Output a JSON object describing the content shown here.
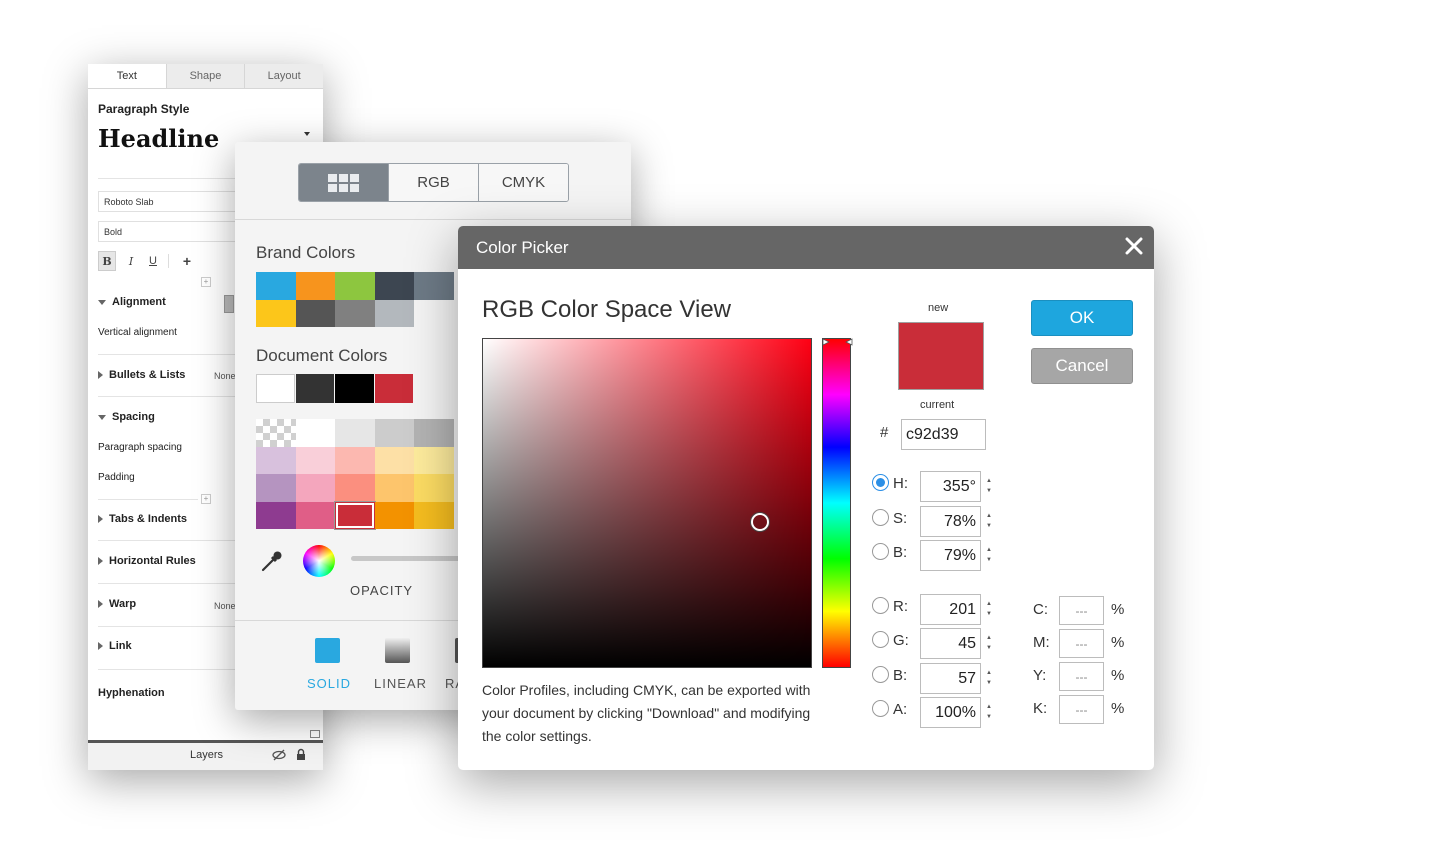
{
  "text_panel": {
    "tabs": [
      "Text",
      "Shape",
      "Layout"
    ],
    "paragraph_style_label": "Paragraph Style",
    "headline": "Headline",
    "font_family": "Roboto Slab",
    "font_weight": "Bold",
    "format_buttons": [
      "B",
      "I",
      "U",
      "+"
    ],
    "alignment": "Alignment",
    "vertical_alignment": "Vertical alignment",
    "bullets": "Bullets & Lists",
    "bullets_value": "None",
    "spacing": "Spacing",
    "paragraph_spacing": "Paragraph spacing",
    "padding": "Padding",
    "tabs_indents": "Tabs & Indents",
    "horizontal_rules": "Horizontal Rules",
    "warp": "Warp",
    "warp_value": "None",
    "link": "Link",
    "hyphenation": "Hyphenation",
    "layers": "Layers"
  },
  "colors_panel": {
    "modes": [
      "RGB",
      "CMYK"
    ],
    "brand_colors_label": "Brand Colors",
    "brand_colors": [
      "#29a8e0",
      "#f7941d",
      "#8dc63f",
      "#3d4651",
      "#6d7a86",
      "#fcc61a",
      "#555555",
      "#808080",
      "#b3b8bd"
    ],
    "document_colors_label": "Document Colors",
    "document_colors": [
      "#ffffff",
      "#333333",
      "#000000",
      "#c92d39"
    ],
    "palette_rows": [
      [
        "#ffffff",
        "#e6e6e6",
        "#cccccc",
        "#b3b3b3"
      ],
      [
        "#d8c1dd",
        "#f9cfd9",
        "#fcb8b0",
        "#fde0a6",
        "#fdeb9c"
      ],
      [
        "#b594c0",
        "#f4a6bd",
        "#fb8f7f",
        "#fdc56c",
        "#fcdc63"
      ],
      [
        "#8e3b90",
        "#e05e87",
        "#c92d39",
        "#f39200",
        "#f5bd1f"
      ]
    ],
    "opacity_label": "OPACITY",
    "fill_types": [
      "SOLID",
      "LINEAR",
      "RA"
    ]
  },
  "color_picker": {
    "title": "Color Picker",
    "heading": "RGB Color Space View",
    "new_label": "new",
    "current_label": "current",
    "hash": "#",
    "hex": "c92d39",
    "hsb": {
      "H": "355°",
      "S": "78%",
      "B": "79%"
    },
    "labels": {
      "H": "H:",
      "S": "S:",
      "B": "B:",
      "R": "R:",
      "G": "G:",
      "B2": "B:",
      "A": "A:",
      "C": "C:",
      "M": "M:",
      "Y": "Y:",
      "K": "K:"
    },
    "rgba": {
      "R": "201",
      "G": "45",
      "B": "57",
      "A": "100%"
    },
    "cmyk": {
      "C": "---",
      "M": "---",
      "Y": "---",
      "K": "---"
    },
    "percent": "%",
    "note": "Color Profiles, including CMYK, can be exported with your document by clicking \"Download\" and modifying the color settings.",
    "ok": "OK",
    "cancel": "Cancel",
    "colors": {
      "ok": "#1ea6de",
      "cancel": "#a6a6a6",
      "selected": "#c92d39"
    }
  }
}
